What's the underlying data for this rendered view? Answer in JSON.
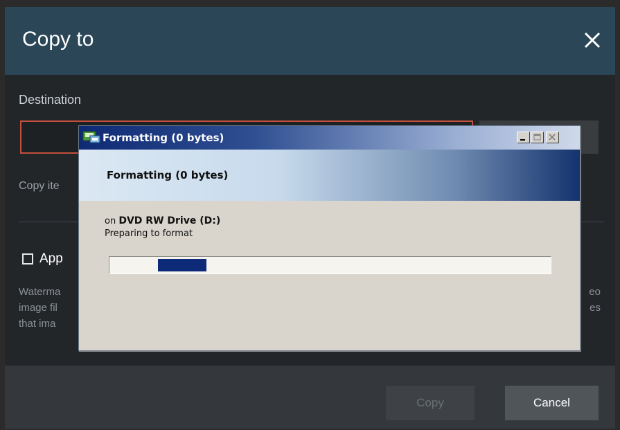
{
  "copy_dialog": {
    "title": "Copy to",
    "destination_label": "Destination",
    "destination_value": "",
    "copy_items_text": "Copy ite",
    "apply_label": "App",
    "apply_checked": false,
    "description_lines": [
      {
        "left": "Waterma",
        "right": "eo"
      },
      {
        "left": "image fil",
        "right": "es"
      },
      {
        "left": "that ima",
        "right": ""
      }
    ],
    "copy_button": "Copy",
    "cancel_button": "Cancel"
  },
  "format_dialog": {
    "title": "Formatting (0 bytes)",
    "banner": "Formatting (0 bytes)",
    "on_prefix": "on",
    "drive": "DVD RW Drive (D:)",
    "status": "Preparing to format",
    "progress": {
      "marquee_start": 0.11,
      "marquee_end": 0.22
    },
    "title_icon": "format-disk-icon",
    "window_buttons": [
      "minimize-icon",
      "maximize-icon",
      "close-icon"
    ]
  },
  "colors": {
    "header": "#2b4656",
    "input_border_error": "#c2503c",
    "progress_fill": "#0d2a78"
  }
}
